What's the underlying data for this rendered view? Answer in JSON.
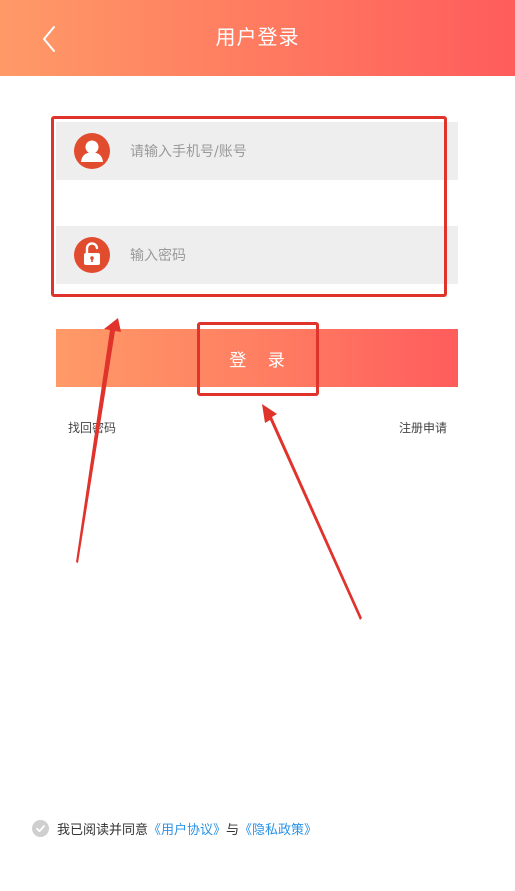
{
  "header": {
    "title": "用户登录"
  },
  "form": {
    "phone_placeholder": "请输入手机号/账号",
    "password_placeholder": "输入密码",
    "login_label": "登 录"
  },
  "links": {
    "forgot_password": "找回密码",
    "register": "注册申请"
  },
  "agreement": {
    "prefix": "我已阅读并同意",
    "user_agreement": "《用户协议》",
    "conjunction": "与",
    "privacy_policy": "《隐私政策》"
  },
  "colors": {
    "header_gradient_start": "#ff9a67",
    "header_gradient_end": "#ff5c5c",
    "icon_red": "#e14b2e",
    "link_blue": "#2a92e6",
    "annotation_red": "#e0332b"
  },
  "icons": {
    "back": "chevron-left-icon",
    "user": "user-icon",
    "lock": "unlock-icon",
    "check": "check-circle-icon"
  }
}
